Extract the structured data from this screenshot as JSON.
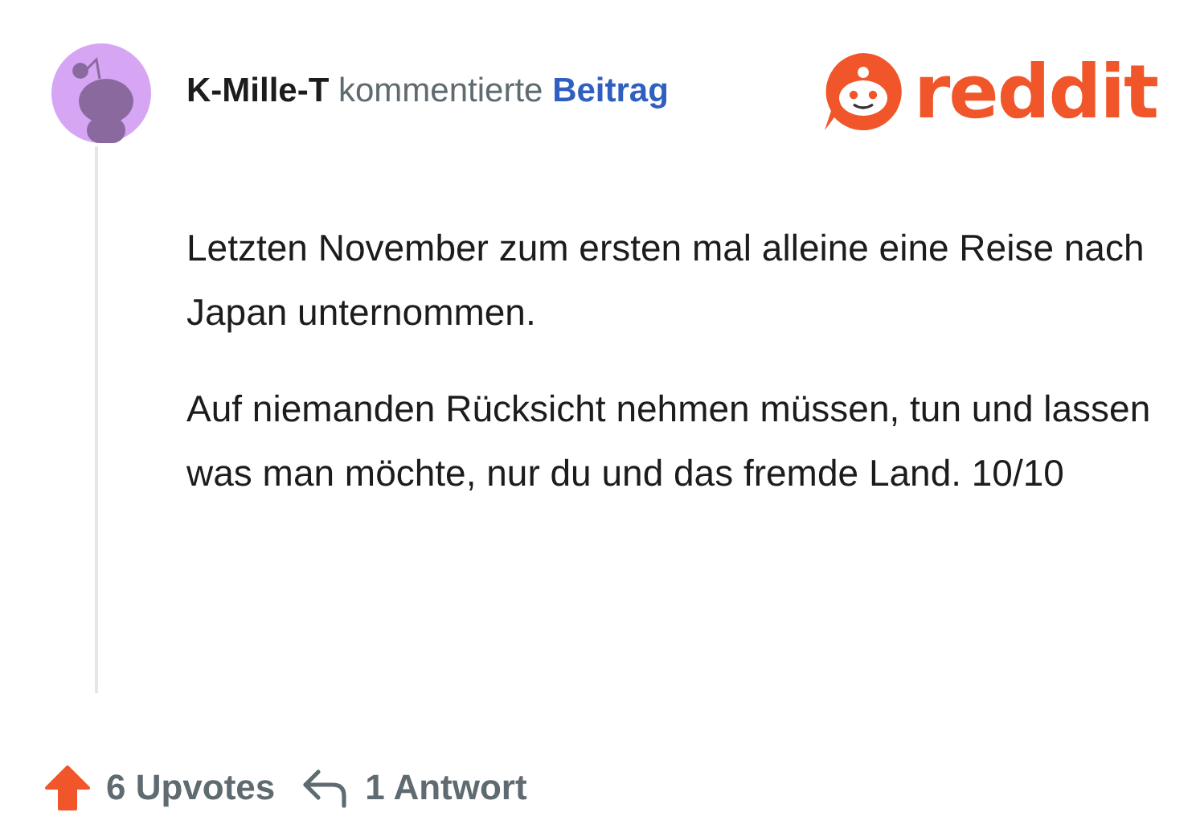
{
  "comment": {
    "author": "K-Mille-T",
    "action": "kommentierte",
    "target": "Beitrag"
  },
  "logo": {
    "text": "reddit"
  },
  "paragraphs": [
    "Letzten November zum ersten mal alleine eine Reise nach Japan unternommen.",
    "Auf niemanden Rücksicht nehmen müssen, tun und lassen was man möchte, nur du und das fremde Land. 10/10"
  ],
  "footer": {
    "upvotes": "6 Upvotes",
    "upvoted": true,
    "replies": "1 Antwort"
  }
}
